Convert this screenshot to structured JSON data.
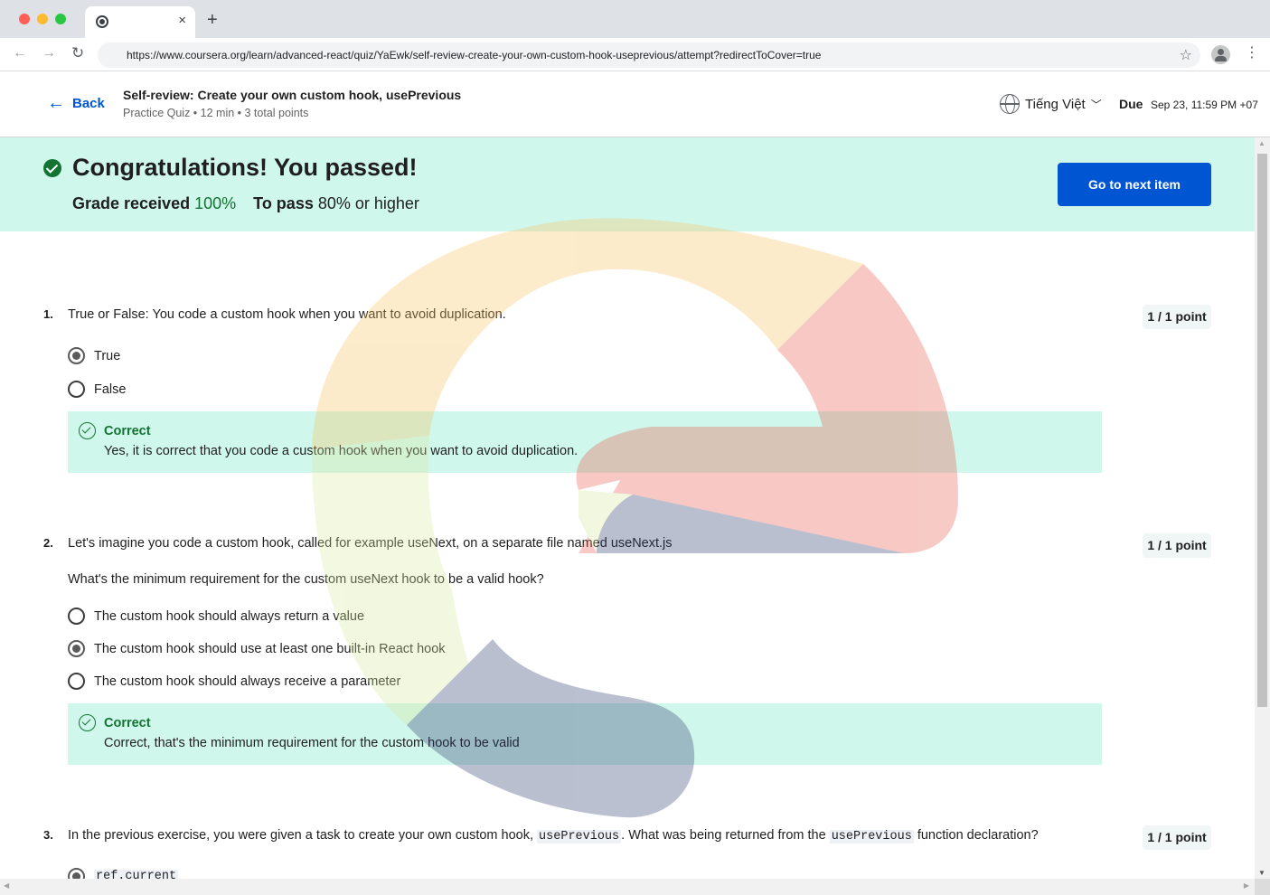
{
  "browser": {
    "url": "https://www.coursera.org/learn/advanced-react/quiz/YaEwk/self-review-create-your-own-custom-hook-useprevious/attempt?redirectToCover=true",
    "tab_close": "×",
    "new_tab": "+"
  },
  "header": {
    "back_label": "Back",
    "title": "Self-review: Create your own custom hook, usePrevious",
    "meta": "Practice Quiz • 12 min • 3 total points",
    "language": "Tiếng Việt",
    "due_label": "Due",
    "due_value": "Sep 23, 11:59 PM +07"
  },
  "banner": {
    "title": "Congratulations! You passed!",
    "grade_label": "Grade received",
    "grade_value": "100%",
    "pass_label": "To pass",
    "pass_value": "80% or higher",
    "next_button": "Go to next item"
  },
  "questions": [
    {
      "number": "1.",
      "text": "True or False: You code a custom hook when you want to avoid duplication.",
      "points": "1 / 1 point",
      "options": [
        {
          "label": "True",
          "selected": true
        },
        {
          "label": "False",
          "selected": false
        }
      ],
      "feedback_title": "Correct",
      "feedback_text": "Yes, it is correct that you code a custom hook when you want to avoid duplication."
    },
    {
      "number": "2.",
      "text": "Let's imagine you code a custom hook, called for example useNext, on a separate file named useNext.js",
      "subtext": "What's the minimum requirement for the custom useNext hook to be a valid hook?",
      "points": "1 / 1 point",
      "options": [
        {
          "label": "The custom hook should always return a value",
          "selected": false
        },
        {
          "label": "The custom hook should use at least one built-in React hook",
          "selected": true
        },
        {
          "label": "The custom hook should always receive a parameter",
          "selected": false
        }
      ],
      "feedback_title": "Correct",
      "feedback_text": "Correct, that's the minimum requirement for the custom hook to be valid"
    },
    {
      "number": "3.",
      "text_before": "In the previous exercise, you were given a task to create your own custom hook,",
      "code1": "usePrevious",
      "text_middle": ". What was being returned from the",
      "code2": "usePrevious",
      "text_after": "function declaration?",
      "points": "1 / 1 point",
      "options": [
        {
          "label": "ref.current",
          "selected": true
        }
      ]
    }
  ],
  "colors": {
    "accent": "#0056d2",
    "success": "#137333",
    "banner_bg": "#d0f7ec"
  }
}
